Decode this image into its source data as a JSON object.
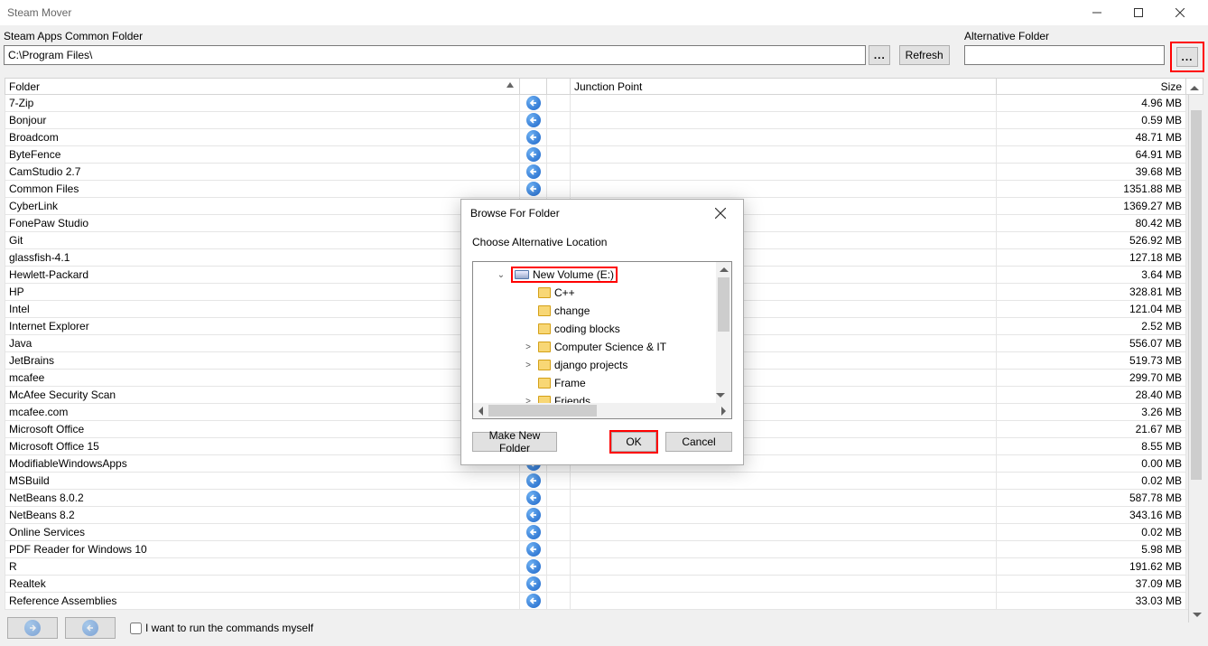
{
  "window": {
    "title": "Steam Mover"
  },
  "toolbar": {
    "source_label": "Steam Apps Common Folder",
    "source_path": "C:\\Program Files\\",
    "browse_dots": "...",
    "refresh": "Refresh",
    "alt_label": "Alternative Folder",
    "alt_path": ""
  },
  "columns": {
    "folder": "Folder",
    "junction": "Junction Point",
    "size": "Size"
  },
  "rows": [
    {
      "folder": "7-Zip",
      "junction": "",
      "size": "4.96 MB"
    },
    {
      "folder": "Bonjour",
      "junction": "",
      "size": "0.59 MB"
    },
    {
      "folder": "Broadcom",
      "junction": "",
      "size": "48.71 MB"
    },
    {
      "folder": "ByteFence",
      "junction": "",
      "size": "64.91 MB"
    },
    {
      "folder": "CamStudio 2.7",
      "junction": "",
      "size": "39.68 MB"
    },
    {
      "folder": "Common Files",
      "junction": "",
      "size": "1351.88 MB"
    },
    {
      "folder": "CyberLink",
      "junction": "",
      "size": "1369.27 MB"
    },
    {
      "folder": "FonePaw Studio",
      "junction": "",
      "size": "80.42 MB"
    },
    {
      "folder": "Git",
      "junction": "",
      "size": "526.92 MB"
    },
    {
      "folder": "glassfish-4.1",
      "junction": "",
      "size": "127.18 MB"
    },
    {
      "folder": "Hewlett-Packard",
      "junction": "",
      "size": "3.64 MB"
    },
    {
      "folder": "HP",
      "junction": "",
      "size": "328.81 MB"
    },
    {
      "folder": "Intel",
      "junction": "",
      "size": "121.04 MB"
    },
    {
      "folder": "Internet Explorer",
      "junction": "",
      "size": "2.52 MB"
    },
    {
      "folder": "Java",
      "junction": "",
      "size": "556.07 MB"
    },
    {
      "folder": "JetBrains",
      "junction": "",
      "size": "519.73 MB"
    },
    {
      "folder": "mcafee",
      "junction": "",
      "size": "299.70 MB"
    },
    {
      "folder": "McAfee Security Scan",
      "junction": "",
      "size": "28.40 MB"
    },
    {
      "folder": "mcafee.com",
      "junction": "",
      "size": "3.26 MB"
    },
    {
      "folder": "Microsoft Office",
      "junction": "",
      "size": "21.67 MB"
    },
    {
      "folder": "Microsoft Office 15",
      "junction": "",
      "size": "8.55 MB"
    },
    {
      "folder": "ModifiableWindowsApps",
      "junction": "",
      "size": "0.00 MB"
    },
    {
      "folder": "MSBuild",
      "junction": "",
      "size": "0.02 MB"
    },
    {
      "folder": "NetBeans 8.0.2",
      "junction": "",
      "size": "587.78 MB"
    },
    {
      "folder": "NetBeans 8.2",
      "junction": "",
      "size": "343.16 MB"
    },
    {
      "folder": "Online Services",
      "junction": "",
      "size": "0.02 MB"
    },
    {
      "folder": "PDF Reader for Windows 10",
      "junction": "",
      "size": "5.98 MB"
    },
    {
      "folder": "R",
      "junction": "",
      "size": "191.62 MB"
    },
    {
      "folder": "Realtek",
      "junction": "",
      "size": "37.09 MB"
    },
    {
      "folder": "Reference Assemblies",
      "junction": "",
      "size": "33.03 MB"
    }
  ],
  "bottom": {
    "checkbox_label": "I want to run the commands myself"
  },
  "dialog": {
    "title": "Browse For Folder",
    "instruction": "Choose Alternative Location",
    "tree": {
      "drive": "New Volume (E:)",
      "items": [
        {
          "label": "C++",
          "expander": ""
        },
        {
          "label": "change",
          "expander": ""
        },
        {
          "label": "coding blocks",
          "expander": ""
        },
        {
          "label": "Computer Science & IT",
          "expander": ">"
        },
        {
          "label": "django projects",
          "expander": ">"
        },
        {
          "label": "Frame",
          "expander": ""
        },
        {
          "label": "Friends",
          "expander": ">"
        }
      ]
    },
    "make_new": "Make New Folder",
    "ok": "OK",
    "cancel": "Cancel"
  }
}
